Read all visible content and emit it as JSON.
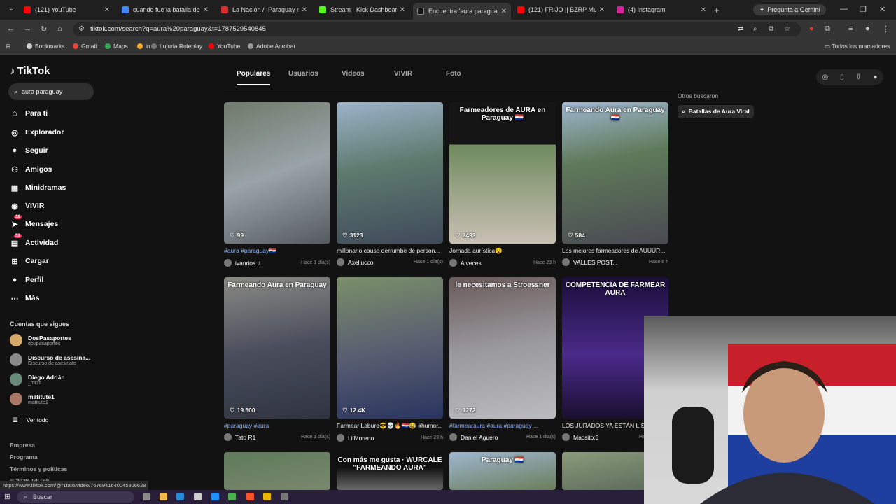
{
  "browser": {
    "tabs": [
      {
        "title": "(121) YouTube",
        "color": "#ff0000"
      },
      {
        "title": "cuando fue la batalla de a",
        "color": "#4285f4"
      },
      {
        "title": "La Nación / ¡Paraguay no",
        "color": "#d92d2d"
      },
      {
        "title": "Stream - Kick Dashboard",
        "color": "#53fc18"
      },
      {
        "title": "Encuentra 'aura paraguay'",
        "color": "#111111"
      },
      {
        "title": "(121) FRIJO || BZRP Music",
        "color": "#ff0000"
      },
      {
        "title": "(4) Instagram",
        "color": "#d6249f"
      }
    ],
    "gemini_label": "Pregunta a Gemini",
    "url": "tiktok.com/search?q=aura%20paraguay&t=1787529540845",
    "bookmarks": [
      {
        "label": "Bookmarks",
        "color": "#cccccc"
      },
      {
        "label": "Gmail",
        "color": "#ea4335"
      },
      {
        "label": "Maps",
        "color": "#34a853"
      },
      {
        "label": "in",
        "color": "#f9a825"
      },
      {
        "label": "Lujuria Roleplay",
        "color": "#777777"
      },
      {
        "label": "YouTube",
        "color": "#ff0000"
      },
      {
        "label": "Adobe Acrobat",
        "color": "#999999"
      }
    ],
    "all_bookmarks": "Todos los marcadores",
    "status_url": "https://www.tiktok.com/@r1tato/video/7676941640045806628"
  },
  "sidebar": {
    "logo": "TikTok",
    "search_value": "aura paraguay",
    "nav": [
      {
        "label": "Para ti",
        "icon": "home-icon",
        "glyph": "⌂"
      },
      {
        "label": "Explorador",
        "icon": "compass-icon",
        "glyph": "◎"
      },
      {
        "label": "Seguir",
        "icon": "avatar-icon",
        "glyph": "●"
      },
      {
        "label": "Amigos",
        "icon": "friends-icon",
        "glyph": "⚇"
      },
      {
        "label": "Minidramas",
        "icon": "film-icon",
        "glyph": "▦"
      },
      {
        "label": "VIVIR",
        "icon": "live-icon",
        "glyph": "◉"
      },
      {
        "label": "Mensajes",
        "icon": "send-icon",
        "glyph": "➤",
        "badge": "16"
      },
      {
        "label": "Actividad",
        "icon": "inbox-icon",
        "glyph": "▤",
        "badge": "53"
      },
      {
        "label": "Cargar",
        "icon": "upload-icon",
        "glyph": "⊞"
      },
      {
        "label": "Perfil",
        "icon": "profile-icon",
        "glyph": "●"
      },
      {
        "label": "Más",
        "icon": "more-icon",
        "glyph": "⋯"
      }
    ],
    "following_title": "Cuentas que sigues",
    "following": [
      {
        "name": "DosPasaportes",
        "handle": "do2pasaportes",
        "color": "#d6a86a"
      },
      {
        "name": "Discurso de asesina...",
        "handle": "Discurso de asesinato",
        "color": "#8a8a8a"
      },
      {
        "name": "Diego Adrián",
        "handle": "_mrzd",
        "color": "#6a8a7a"
      },
      {
        "name": "matitute1",
        "handle": "matitute1",
        "color": "#aa7766"
      }
    ],
    "see_all": "Ver todo",
    "footer": [
      "Empresa",
      "Programa",
      "Términos y políticas",
      "© 2026 TikTok"
    ]
  },
  "search_tabs": [
    {
      "label": "Populares",
      "active": true
    },
    {
      "label": "Usuarios",
      "active": false
    },
    {
      "label": "Videos",
      "active": false
    },
    {
      "label": "VIVIR",
      "active": false
    },
    {
      "label": "Foto",
      "active": false
    }
  ],
  "related": {
    "title": "Otros buscaron",
    "items": [
      "Batallas de Aura Viral"
    ]
  },
  "videos": [
    {
      "likes": "99",
      "desc": "#aura #paraguay🇵🇾",
      "tag": true,
      "user": "ivanrios.tt",
      "time": "Hace 1 día(s)",
      "bg": "linear-gradient(160deg,#6f7a6a,#9aa3a8 50%,#555a60)",
      "caption": ""
    },
    {
      "likes": "3123",
      "desc": "millonario causa derrumbe de person...",
      "tag": false,
      "user": "Axellucco",
      "time": "Hace 1 día(s)",
      "bg": "linear-gradient(170deg,#9cb3c9,#5e7a6e 45%,#3f4a5a)",
      "caption": ""
    },
    {
      "likes": "2492",
      "desc": "Jornada aurística😵",
      "tag": false,
      "user": "A veces",
      "time": "Hace 23 h",
      "bg": "linear-gradient(180deg,#151515 0 30%,#6f8a5e 30%,#c9c0b4)",
      "caption": "Farmeadores de AURA en Paraguay 🇵🇾"
    },
    {
      "likes": "584",
      "desc": "Los mejores farmeadores de AUUUR...",
      "tag": false,
      "user": "VALLES POST...",
      "time": "Hace 8 h",
      "bg": "linear-gradient(170deg,#9fb6d0,#5f7a5a 40%,#4a4a52)",
      "caption": "Farmeando Aura en Paraguay 🇵🇾"
    },
    {
      "likes": "19.600",
      "desc": "#paraguay #aura",
      "tag": true,
      "user": "Tato R1",
      "time": "Hace 1 día(s)",
      "bg": "linear-gradient(170deg,#8a8a84,#4a4e5c 50%,#2f3440)",
      "caption": "Farmeando Aura en Paraguay"
    },
    {
      "likes": "12.4K",
      "desc": "Farmear Laburo😎💀🔥🇵🇾😂 #humor...",
      "tag": false,
      "user": "LilMoreno",
      "time": "Hace 23 h",
      "bg": "linear-gradient(170deg,#7a8f6a,#5a5f70 50%,#2a3560)",
      "caption": ""
    },
    {
      "likes": "1272",
      "desc": "#farmearaura #aura #paraguay ...",
      "tag": true,
      "user": "Daniel Aguero",
      "time": "Hace 1 día(s)",
      "bg": "linear-gradient(170deg,#6a5a5a,#9a9a9e 50%,#bcbcc0)",
      "caption": "le necesitamos a Stroessner"
    },
    {
      "likes": "",
      "desc": "LOS JURADOS YA ESTÁN LISTOS",
      "tag": false,
      "user": "Macsito:3",
      "time": "Hace 1 día(s)",
      "bg": "linear-gradient(180deg,#1a0f3a,#4a2a8a 55%,#1a1030)",
      "caption": "COMPETENCIA DE FARMEAR AURA"
    },
    {
      "likes": "",
      "desc": "",
      "tag": false,
      "user": "",
      "time": "",
      "bg": "linear-gradient(170deg,#5f7a5a,#7a8870)",
      "caption": ""
    },
    {
      "likes": "",
      "desc": "",
      "tag": false,
      "user": "",
      "time": "",
      "bg": "linear-gradient(180deg,#111 0 40%,#6a6a6a)",
      "caption": "Con más me gusta · WURCALE \"FARMEANDO AURA\""
    },
    {
      "likes": "",
      "desc": "",
      "tag": false,
      "user": "",
      "time": "",
      "bg": "linear-gradient(170deg,#9fb6d0,#6a7e5a)",
      "caption": "Paraguay 🇵🇾"
    },
    {
      "likes": "",
      "desc": "",
      "tag": false,
      "user": "",
      "time": "",
      "bg": "linear-gradient(170deg,#8a9a7a,#5a6a5a)",
      "caption": ""
    }
  ],
  "taskbar": {
    "search_placeholder": "Buscar"
  }
}
